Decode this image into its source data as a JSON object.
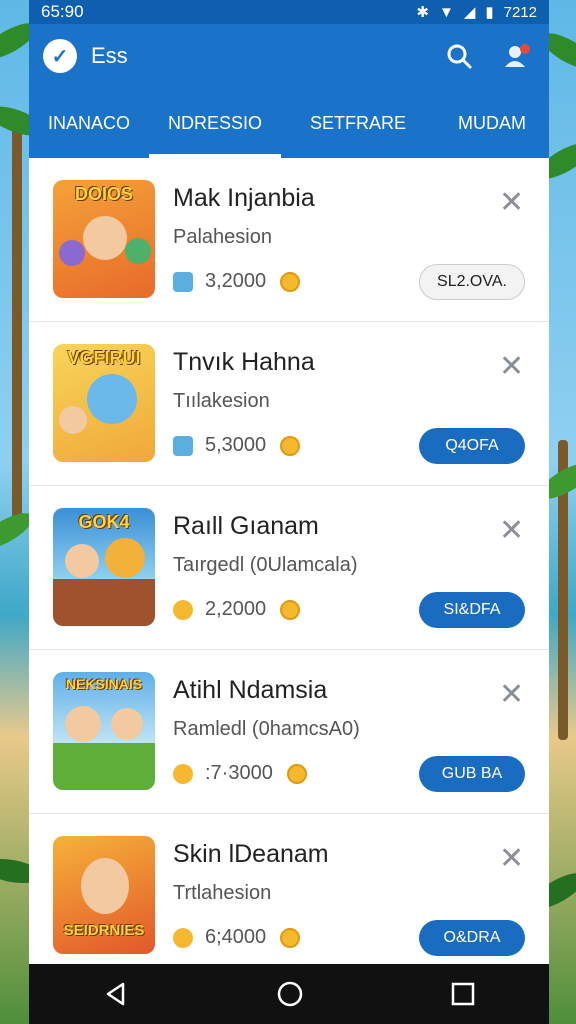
{
  "status_bar": {
    "time": "65:90",
    "right": "7212"
  },
  "app_bar": {
    "title": "Ess"
  },
  "tabs": [
    {
      "label": "INANACO"
    },
    {
      "label": "NDRESSIO",
      "active": true
    },
    {
      "label": "SETFRARE"
    },
    {
      "label": "MUDAM"
    }
  ],
  "items": [
    {
      "thumb_label": "DOIOS",
      "name": "Mak Injanbia",
      "sub": "Palahesion",
      "value": "3,2000",
      "action": "SL2.OVA.",
      "action_style": "light",
      "lead_icon": "basket-icon",
      "thumb_color": "#f4a23a"
    },
    {
      "thumb_label": "VGFIRUI",
      "name": "Tnvık Hahna",
      "sub": "Tıılakesion",
      "value": "5,3000",
      "action": "Q4OFA",
      "action_style": "primary",
      "lead_icon": "basket-icon",
      "thumb_color": "#f7c84a"
    },
    {
      "thumb_label": "GOK4",
      "name": "Raıll Gıanam",
      "sub": "Taırgedl (0Ulamcala)",
      "value": "2,2000",
      "action": "SI&DFA",
      "action_style": "primary",
      "lead_icon": "coin-icon",
      "thumb_color": "#3b8fd6"
    },
    {
      "thumb_label": "NEKSINAIS",
      "name": "Atihl Ndamsia",
      "sub": "Ramledl (0hamcsA0)",
      "value": ":7·3000",
      "action": "GUB BA",
      "action_style": "primary",
      "lead_icon": "coin-icon",
      "thumb_color": "#5fb0e8"
    },
    {
      "thumb_label": "SEIDRNIES",
      "name": "Skin lDeanam",
      "sub": "Trtlahesion",
      "value": "6;4000",
      "action": "O&DRA",
      "action_style": "primary",
      "lead_icon": "coin-icon",
      "thumb_color": "#e2572a"
    }
  ],
  "colors": {
    "primary": "#1a73c9",
    "status": "#0f5fb0",
    "coin": "#f5b82e"
  }
}
